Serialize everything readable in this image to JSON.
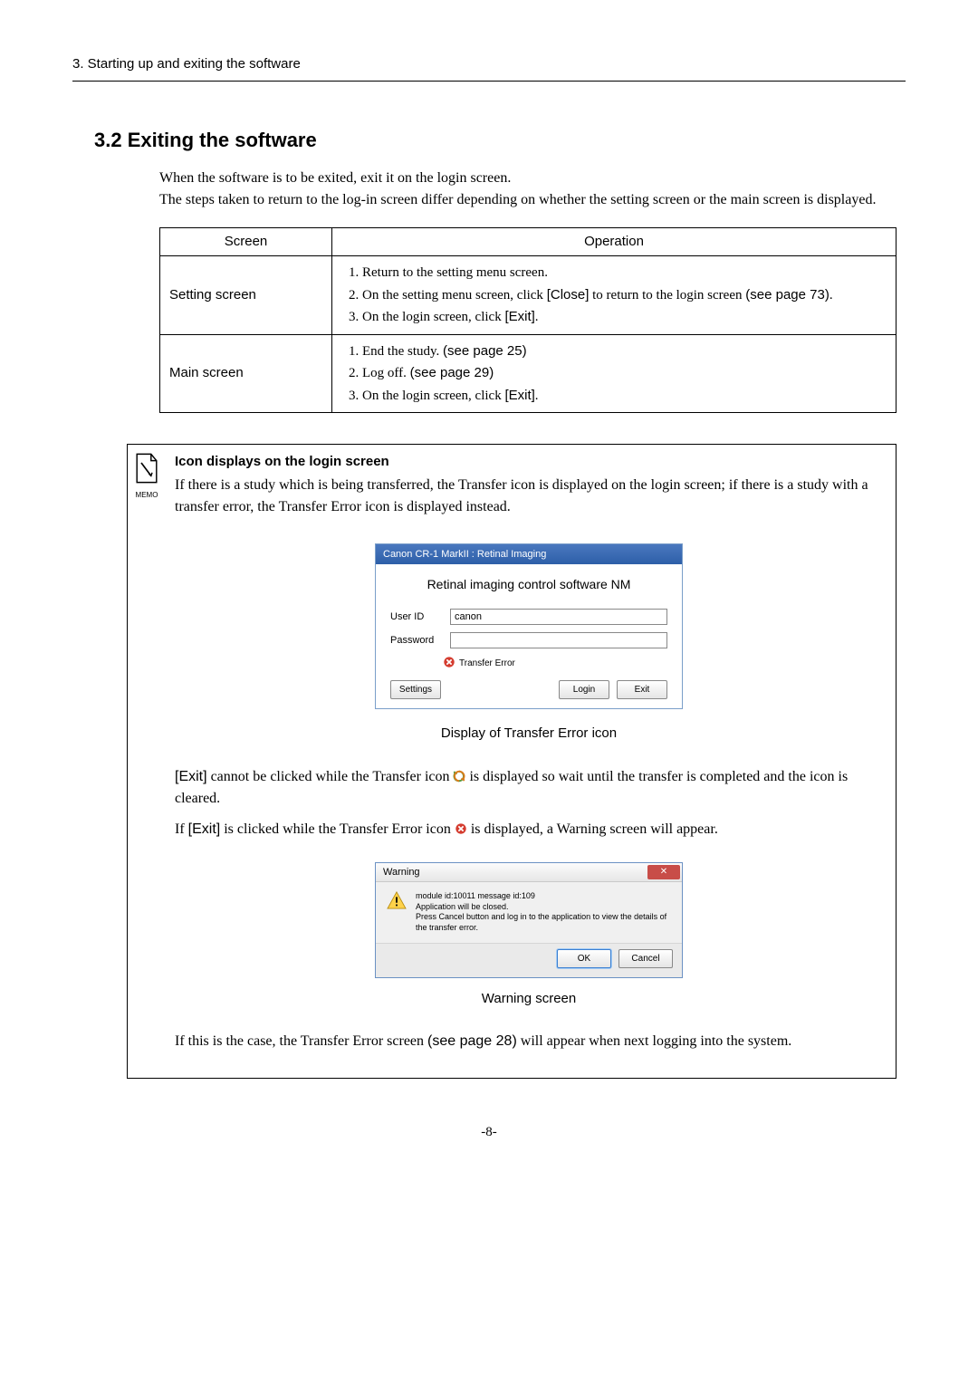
{
  "header": {
    "chapter": "3. Starting up and exiting the software"
  },
  "section": {
    "title": "3.2 Exiting the software",
    "intro1": "When the software is to be exited, exit it on the login screen.",
    "intro2": "The steps taken to return to the log-in screen differ depending on whether the setting screen or the main screen is displayed."
  },
  "table": {
    "head": {
      "c1": "Screen",
      "c2": "Operation"
    },
    "rows": [
      {
        "screen": "Setting screen",
        "steps": [
          "Return to the setting menu screen.",
          "On the setting menu screen, click [Close] to return to the login screen (see page 73).",
          "On the login screen, click [Exit]."
        ],
        "step2_pre": "On the setting menu screen, click ",
        "step2_bold": "[Close]",
        "step2_post": " to return to the login screen ",
        "step2_see": "(see page 73)",
        "step2_end": ".",
        "step3_pre": "On the login screen, click ",
        "step3_bold": "[Exit]",
        "step3_end": "."
      },
      {
        "screen": "Main screen",
        "step1_pre": "End the study. ",
        "step1_see": "(see page 25)",
        "step2_pre": "Log off. ",
        "step2_see": "(see page 29)",
        "step3_pre": "On the login screen, click ",
        "step3_bold": "[Exit]",
        "step3_end": "."
      }
    ]
  },
  "memo": {
    "label": "MEMO",
    "heading": "Icon displays on the login screen",
    "p1": "If there is a study which is being transferred, the Transfer icon is displayed on the login screen; if there is a study with a transfer error, the Transfer Error icon is displayed instead."
  },
  "login": {
    "title": "Canon CR-1 MarkII : Retinal Imaging",
    "heading": "Retinal imaging control software NM",
    "userid_label": "User ID",
    "userid_value": "canon",
    "password_label": "Password",
    "status_text": "Transfer Error",
    "btn_settings": "Settings",
    "btn_login": "Login",
    "btn_exit": "Exit"
  },
  "login_caption": "Display of Transfer Error icon",
  "memo_p2_bold1": "[Exit]",
  "memo_p2_rest": " cannot be clicked while the Transfer icon ",
  "memo_p2_after": " is displayed so wait until the transfer is completed and the icon is cleared.",
  "memo_p3_pre": "If ",
  "memo_p3_bold": "[Exit]",
  "memo_p3_mid": " is clicked while the Transfer Error icon ",
  "memo_p3_after": " is displayed, a Warning screen will appear.",
  "warning": {
    "title": "Warning",
    "line1": "module id:10011 message id:109",
    "line2": "Application will be closed.",
    "line3": "Press Cancel button and log in to the application to view the details of the transfer error.",
    "btn_ok": "OK",
    "btn_cancel": "Cancel"
  },
  "warning_caption": "Warning screen",
  "memo_p4_pre": "If this is the case, the Transfer Error screen ",
  "memo_p4_see": "(see page 28)",
  "memo_p4_after": " will appear when next logging into the system.",
  "footer": {
    "page": "-8-"
  }
}
